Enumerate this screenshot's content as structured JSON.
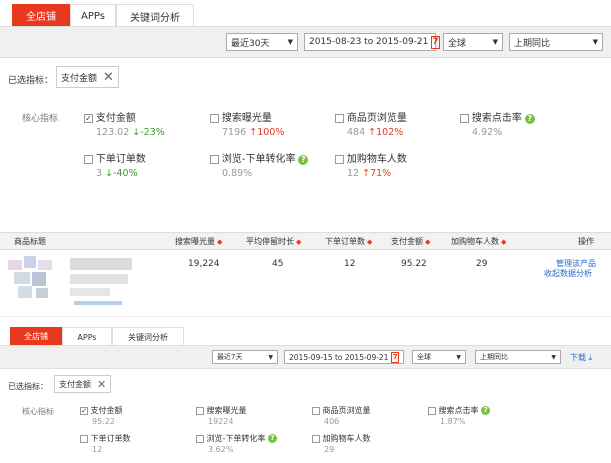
{
  "top": {
    "tabs": [
      {
        "label": "全店铺"
      },
      {
        "label": "APPs"
      },
      {
        "label": "关键词分析"
      }
    ],
    "period_select": "最近30天",
    "date_range": "2015-08-23 to 2015-09-21",
    "calendar_glyph": "7",
    "channel_select": "全球",
    "compare_select": "上期同比",
    "selected_label": "已选指标：",
    "selected_chip": "支付金额",
    "core_label": "核心指标",
    "metrics": [
      {
        "name": "支付金额",
        "value": "123.02",
        "dir": "↓",
        "change": "-23%",
        "checked": true,
        "help": false
      },
      {
        "name": "搜索曝光量",
        "value": "7196",
        "dir": "↑",
        "change": "100%",
        "checked": false,
        "help": false
      },
      {
        "name": "商品页浏览量",
        "value": "484",
        "dir": "↑",
        "change": "102%",
        "checked": false,
        "help": false
      },
      {
        "name": "搜索点击率",
        "value": "4.92%",
        "dir": "",
        "change": "",
        "checked": false,
        "help": true
      },
      {
        "name": "下单订单数",
        "value": "3",
        "dir": "↓",
        "change": "-40%",
        "checked": false,
        "help": false
      },
      {
        "name": "浏览-下单转化率",
        "value": "0.89%",
        "dir": "",
        "change": "",
        "checked": false,
        "help": true
      },
      {
        "name": "加购物车人数",
        "value": "12",
        "dir": "↑",
        "change": "71%",
        "checked": false,
        "help": false
      }
    ]
  },
  "table": {
    "headers": [
      "商品标题",
      "搜索曝光量",
      "平均停留时长",
      "下单订单数",
      "支付金额",
      "加购物车人数",
      "操作"
    ],
    "sort_glyph": "◆",
    "row": {
      "exposure": "19,224",
      "avg_stay": "45",
      "orders": "12",
      "amount": "95.22",
      "cart": "29"
    },
    "actions": [
      "管理该产品",
      "收起数据分析"
    ]
  },
  "bottom": {
    "tabs": [
      {
        "label": "全店铺"
      },
      {
        "label": "APPs"
      },
      {
        "label": "关键词分析"
      }
    ],
    "period_select": "最近7天",
    "date_range": "2015-09-15 to 2015-09-21",
    "calendar_glyph": "7",
    "channel_select": "全球",
    "compare_select": "上期同比",
    "download_label": "下载",
    "download_icon": "download-icon",
    "selected_label": "已选指标：",
    "selected_chip": "支付金额",
    "core_label": "核心指标",
    "metrics": [
      {
        "name": "支付金额",
        "value": "95.22",
        "checked": true,
        "help": false
      },
      {
        "name": "搜索曝光量",
        "value": "19224",
        "checked": false,
        "help": false
      },
      {
        "name": "商品页浏览量",
        "value": "406",
        "checked": false,
        "help": false
      },
      {
        "name": "搜索点击率",
        "value": "1.87%",
        "checked": false,
        "help": true
      },
      {
        "name": "下单订单数",
        "value": "12",
        "checked": false,
        "help": false
      },
      {
        "name": "浏览-下单转化率",
        "value": "3.62%",
        "checked": false,
        "help": true
      },
      {
        "name": "加购物车人数",
        "value": "29",
        "checked": false,
        "help": false
      }
    ]
  },
  "colors": {
    "accent": "#e8391f",
    "up": "#e8391f",
    "down": "#3a9d2b",
    "link": "#2a6bc8",
    "help": "#7ac143"
  }
}
